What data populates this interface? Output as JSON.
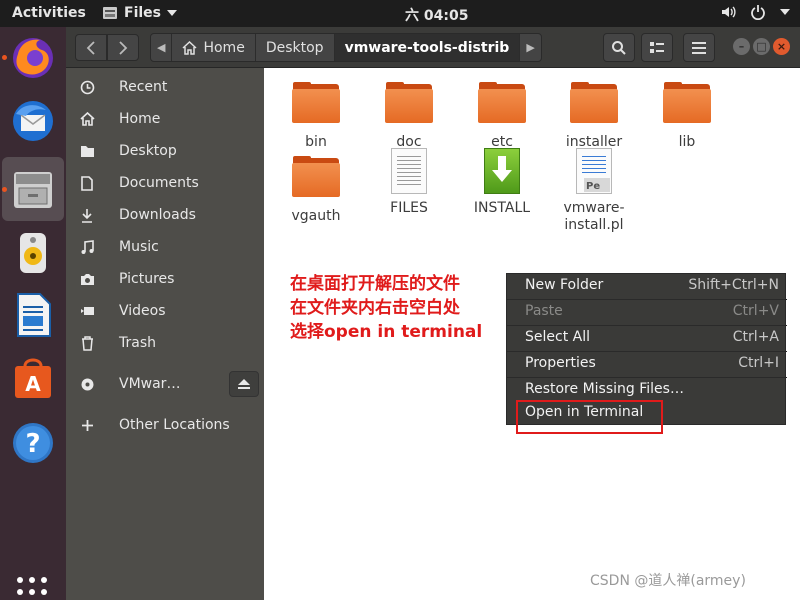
{
  "topbar": {
    "activities": "Activities",
    "app_name": "Files",
    "clock": "六 04:05"
  },
  "dock": {
    "items": [
      "firefox-icon",
      "thunderbird-icon",
      "files-icon",
      "rhythmbox-icon",
      "writer-icon",
      "software-icon",
      "help-icon"
    ],
    "show_apps": "show-applications-icon"
  },
  "header": {
    "path": {
      "home": "Home",
      "desktop": "Desktop",
      "current": "vmware-tools-distrib"
    }
  },
  "sidebar": {
    "items": [
      {
        "label": "Recent",
        "icon": "clock-icon"
      },
      {
        "label": "Home",
        "icon": "home-icon"
      },
      {
        "label": "Desktop",
        "icon": "folder-icon"
      },
      {
        "label": "Documents",
        "icon": "document-icon"
      },
      {
        "label": "Downloads",
        "icon": "download-icon"
      },
      {
        "label": "Music",
        "icon": "music-icon"
      },
      {
        "label": "Pictures",
        "icon": "camera-icon"
      },
      {
        "label": "Videos",
        "icon": "video-icon"
      },
      {
        "label": "Trash",
        "icon": "trash-icon"
      },
      {
        "label": "VMwar…",
        "icon": "disc-icon"
      },
      {
        "label": "Other Locations",
        "icon": "plus-icon"
      }
    ]
  },
  "files": [
    {
      "name": "bin",
      "type": "folder"
    },
    {
      "name": "doc",
      "type": "folder"
    },
    {
      "name": "etc",
      "type": "folder"
    },
    {
      "name": "installer",
      "type": "folder"
    },
    {
      "name": "lib",
      "type": "folder"
    },
    {
      "name": "vgauth",
      "type": "folder"
    },
    {
      "name": "FILES",
      "type": "text"
    },
    {
      "name": "INSTALL",
      "type": "install"
    },
    {
      "name": "vmware-\ninstall.pl",
      "type": "perl"
    }
  ],
  "annotation": {
    "line1": "在桌面打开解压的文件",
    "line2": "在文件夹内右击空白处",
    "line3": "选择open in terminal"
  },
  "context_menu": {
    "items": [
      {
        "label": "New Folder",
        "shortcut": "Shift+Ctrl+N",
        "enabled": true
      },
      {
        "label": "Paste",
        "shortcut": "Ctrl+V",
        "enabled": false
      },
      {
        "label": "Select All",
        "shortcut": "Ctrl+A",
        "enabled": true
      },
      {
        "label": "Properties",
        "shortcut": "Ctrl+I",
        "enabled": true
      },
      {
        "label": "Restore Missing Files…",
        "shortcut": "",
        "enabled": true
      },
      {
        "label": "Open in Terminal",
        "shortcut": "",
        "enabled": true
      }
    ]
  },
  "watermark": "CSDN @道人禅(armey)",
  "colors": {
    "accent": "#e95420",
    "annotation": "#e01b1b",
    "folder": "#e56a24"
  }
}
